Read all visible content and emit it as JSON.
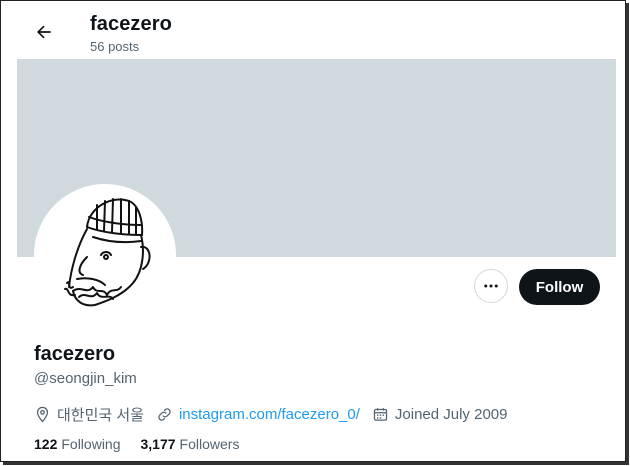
{
  "header": {
    "title": "facezero",
    "posts_count": "56 posts"
  },
  "profile": {
    "display_name": "facezero",
    "handle": "@seongjin_kim",
    "location": "대한민국 서울",
    "website": "instagram.com/facezero_0/",
    "joined": "Joined July 2009",
    "following_count": "122",
    "following_label": "Following",
    "followers_count": "3,177",
    "followers_label": "Followers"
  },
  "actions": {
    "follow_label": "Follow",
    "more_icon": "more-horizontal-icon"
  },
  "icons": {
    "back": "arrow-left-icon",
    "location": "location-pin-icon",
    "link": "link-icon",
    "calendar": "calendar-icon"
  },
  "colors": {
    "banner": "#cfd9de",
    "link": "#1d9bf0",
    "follow_bg": "#0f1419",
    "muted_text": "#536471"
  }
}
